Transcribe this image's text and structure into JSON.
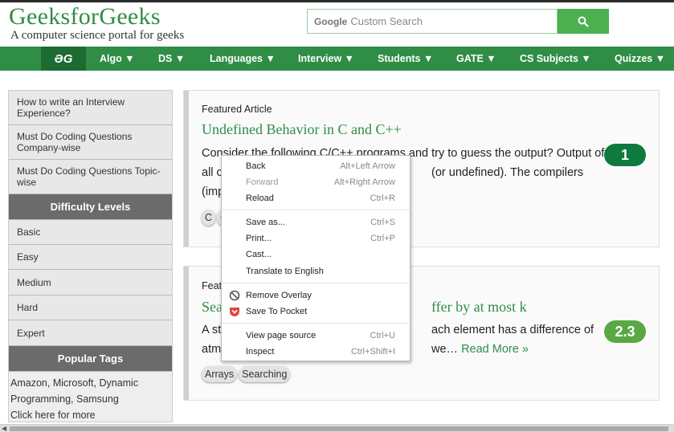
{
  "brand": {
    "logo": "GeeksforGeeks",
    "tagline": "A computer science portal for geeks"
  },
  "search": {
    "google": "Google",
    "placeholder": "Custom Search"
  },
  "nav": {
    "logo": "ƏG",
    "items": [
      "Algo ▼",
      "DS ▼",
      "Languages ▼",
      "Interview ▼",
      "Students ▼",
      "GATE ▼",
      "CS Subjects ▼",
      "Quizzes ▼"
    ]
  },
  "sidebar": {
    "links": [
      "How to write an Interview Experience?",
      "Must Do Coding Questions Company-wise",
      "Must Do Coding Questions Topic-wise"
    ],
    "difficulty_heading": "Difficulty Levels",
    "levels": [
      "Basic",
      "Easy",
      "Medium",
      "Hard",
      "Expert"
    ],
    "tags_heading": "Popular Tags",
    "tags": [
      "Amazon",
      "Microsoft",
      "Dynamic Programming",
      "Samsung"
    ],
    "more": "Click here for more"
  },
  "article1": {
    "label": "Featured Article",
    "title": "Undefined Behavior in C and C++",
    "line1": "Consider the following C/C++ programs and try to guess the output? Output of",
    "line2a": "all c",
    "line2b": "(or undefined). The compilers",
    "line3": "(imp",
    "chip1": "C",
    "chip2": "C",
    "badge": "1"
  },
  "article2": {
    "label": "Feat",
    "title_a": "Sea",
    "title_b": "ffer by at most k",
    "line1a": "A st",
    "line1b": "ach element has a difference of",
    "line2a": "atm",
    "line2b": "we…",
    "read_more": "Read More »",
    "chips": [
      "Arrays",
      "Searching"
    ],
    "badge": "2.3"
  },
  "context_menu": {
    "back": "Back",
    "back_sc": "Alt+Left Arrow",
    "forward": "Forward",
    "forward_sc": "Alt+Right Arrow",
    "reload": "Reload",
    "reload_sc": "Ctrl+R",
    "save_as": "Save as...",
    "save_as_sc": "Ctrl+S",
    "print": "Print...",
    "print_sc": "Ctrl+P",
    "cast": "Cast...",
    "translate": "Translate to English",
    "remove_overlay": "Remove Overlay",
    "save_pocket": "Save To Pocket",
    "view_source": "View page source",
    "view_source_sc": "Ctrl+U",
    "inspect": "Inspect",
    "inspect_sc": "Ctrl+Shift+I"
  },
  "colors": {
    "brand_green": "#2f8d46",
    "badge_dark": "#0f7a3d",
    "badge_light": "#5aa844"
  }
}
